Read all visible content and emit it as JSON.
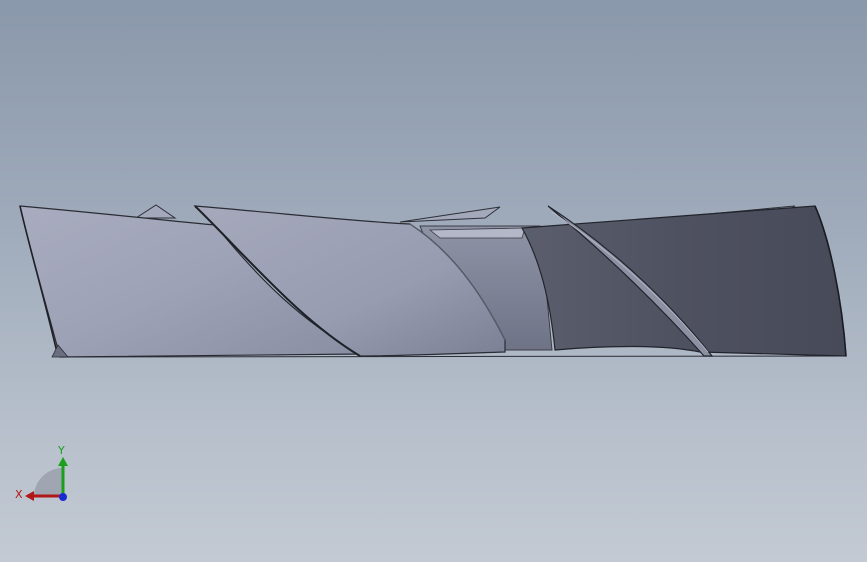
{
  "viewport": {
    "background_top": "#8a98ab",
    "background_bottom": "#c3cad3"
  },
  "triad": {
    "x_label": "X",
    "y_label": "Y",
    "x_color": "#b01818",
    "y_color": "#1aa01a",
    "z_color": "#1a2ad0"
  },
  "model": {
    "description_icon": "screw-rotor-icon",
    "light_color": "#a6a9ba",
    "dark_color": "#4a4c58"
  }
}
